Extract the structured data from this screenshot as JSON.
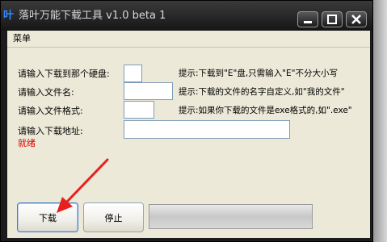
{
  "window": {
    "title": "落叶万能下载工具 v1.0 beta 1",
    "app_icon_glyph": "叶"
  },
  "menu": {
    "items": [
      "菜单"
    ]
  },
  "form": {
    "rows": [
      {
        "label": "请输入下载到那个硬盘:",
        "value": "",
        "hint": "提示:下载到\"E\"盘,只需输入\"E\"不分大小写"
      },
      {
        "label": "请输入文件名:",
        "value": "",
        "hint": "提示:下载的文件的名字自定义,如\"我的文件\""
      },
      {
        "label": "请输入文件格式:",
        "value": "",
        "hint": "提示:如果你下载的文件是exe格式的,如\".exe\""
      },
      {
        "label": "请输入下载地址:",
        "value": ""
      }
    ],
    "status": "就绪"
  },
  "buttons": {
    "download": "下载",
    "stop": "停止"
  },
  "progress": {
    "value": 0
  },
  "colors": {
    "status": "#e00000",
    "arrow": "#e8201e",
    "titlebar": "#1c1c1c"
  }
}
